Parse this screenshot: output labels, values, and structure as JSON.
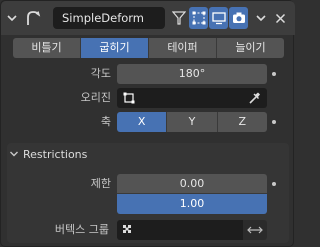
{
  "header": {
    "modifier_name": "SimpleDeform",
    "icons": [
      "chevron-down-icon",
      "simple-deform-icon",
      "funnel-icon",
      "edit-mode-icon",
      "display-viewport-icon",
      "render-camera-icon",
      "dropdown-arrow-icon",
      "close-icon"
    ]
  },
  "tabs": [
    {
      "label": "비틀기",
      "active": false
    },
    {
      "label": "굽히기",
      "active": true
    },
    {
      "label": "테이퍼",
      "active": false
    },
    {
      "label": "늘이기",
      "active": false
    }
  ],
  "angle": {
    "label": "각도",
    "value": "180°"
  },
  "origin": {
    "label": "오리진",
    "value": ""
  },
  "axis": {
    "label": "축",
    "options": [
      {
        "label": "X",
        "active": true
      },
      {
        "label": "Y",
        "active": false
      },
      {
        "label": "Z",
        "active": false
      }
    ]
  },
  "restrictions": {
    "title": "Restrictions",
    "limits": {
      "label": "제한",
      "low": "0.00",
      "high": "1.00"
    },
    "vertex_group": {
      "label": "버텍스 그룹",
      "value": ""
    }
  },
  "colors": {
    "accent": "#4772b3",
    "panel": "#303030",
    "field": "#545454"
  }
}
